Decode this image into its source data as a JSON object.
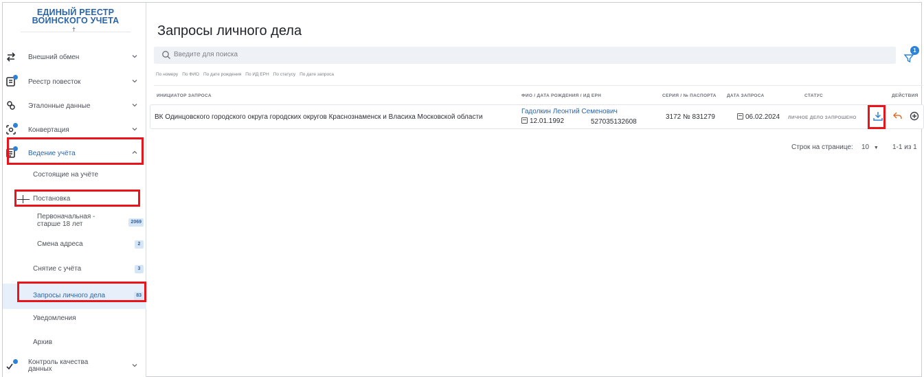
{
  "app": {
    "logo_line1": "ЕДИНЫЙ РЕЕСТР",
    "logo_line2": "ВОИНСКОГО УЧЕТА"
  },
  "sidebar": {
    "items": [
      {
        "label": "Внешний обмен",
        "icon": "arrows-exchange-icon"
      },
      {
        "label": "Реестр повесток",
        "icon": "document-notification-icon"
      },
      {
        "label": "Эталонные данные",
        "icon": "users-icon"
      },
      {
        "label": "Конвертация",
        "icon": "convert-icon"
      },
      {
        "label": "Ведение учёта",
        "icon": "registry-icon"
      }
    ],
    "sub_items": [
      {
        "label": "Состоящие на учёте"
      },
      {
        "label": "Постановка"
      },
      {
        "label": "Первоначальная - старше 18 лет",
        "badge": "2069"
      },
      {
        "label": "Смена адреса",
        "badge": "2"
      },
      {
        "label": "Снятие с учёта",
        "badge": "3"
      },
      {
        "label": "Запросы личного дела",
        "badge": "83"
      },
      {
        "label": "Уведомления"
      },
      {
        "label": "Архив"
      }
    ],
    "quality_label": "Контроль качества данных"
  },
  "main": {
    "title": "Запросы личного дела",
    "search_placeholder": "Введите для поиска",
    "filter_count": "1",
    "chips": [
      "По номеру",
      "По ФИО",
      "По дате рождения",
      "По ИД ЕРН",
      "По статусу",
      "По дате запроса"
    ]
  },
  "table": {
    "headers": [
      "ИНИЦИАТОР ЗАПРОСА",
      "ФИО / ДАТА РОЖДЕНИЯ / ИД ЕРН",
      "СЕРИЯ / № ПАСПОРТА",
      "ДАТА ЗАПРОСА",
      "СТАТУС",
      "ДЕЙСТВИЯ"
    ],
    "rows": [
      {
        "initiator": "ВК Одинцовского городского округа городских округов Краснознаменск и Власиха Московской области",
        "fio": "Гадолкин Леонтий Семенович",
        "birth_date": "12.01.1992",
        "ern_id": "527035132608",
        "passport": "3172 № 831279",
        "request_date": "06.02.2024",
        "status": "ЛИЧНОЕ ДЕЛО ЗАПРОШЕНО"
      }
    ]
  },
  "pager": {
    "rows_label": "Строк на странице:",
    "rows_value": "10",
    "range": "1-1 из 1"
  },
  "colors": {
    "accent": "#2a64a8",
    "highlight": "#e8141a",
    "download": "#2e82d6",
    "reply": "#e0702c"
  }
}
